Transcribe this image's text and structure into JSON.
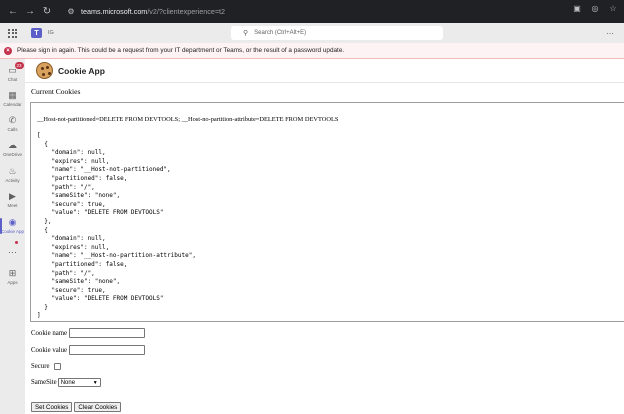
{
  "browser": {
    "url_host": "teams.microsoft.com",
    "url_path": "/v2/?clientexperience=t2"
  },
  "teams_header": {
    "org_label": "IG",
    "search_placeholder": "Search (Ctrl+Alt+E)"
  },
  "banner": {
    "text": "Please sign in again. This could be a request from your IT department or Teams, or the result of a password update."
  },
  "rail": {
    "items": [
      {
        "label": "Chat",
        "icon": "chat-icon",
        "badge": "23"
      },
      {
        "label": "Calendar",
        "icon": "calendar-icon"
      },
      {
        "label": "Calls",
        "icon": "calls-icon"
      },
      {
        "label": "OneDrive",
        "icon": "onedrive-icon"
      },
      {
        "label": "Activity",
        "icon": "activity-icon"
      },
      {
        "label": "Meet",
        "icon": "meet-icon"
      },
      {
        "label": "Cookie App",
        "icon": "cookie-app-icon",
        "active": true
      },
      {
        "label": "",
        "icon": "more-icon"
      },
      {
        "label": "Apps",
        "icon": "apps-icon"
      }
    ],
    "accent": "#5b5fc7"
  },
  "app": {
    "title": "Cookie App",
    "section_title": "Current Cookies",
    "cookie_string": "__Host-not-partitioned=DELETE FROM DEVTOOLS; __Host-no-partition-attribute=DELETE FROM DEVTOOLS",
    "cookies_json": "[\n  {\n    \"domain\": null,\n    \"expires\": null,\n    \"name\": \"__Host-not-partitioned\",\n    \"partitioned\": false,\n    \"path\": \"/\",\n    \"sameSite\": \"none\",\n    \"secure\": true,\n    \"value\": \"DELETE FROM DEVTOOLS\"\n  },\n  {\n    \"domain\": null,\n    \"expires\": null,\n    \"name\": \"__Host-no-partition-attribute\",\n    \"partitioned\": false,\n    \"path\": \"/\",\n    \"sameSite\": \"none\",\n    \"secure\": true,\n    \"value\": \"DELETE FROM DEVTOOLS\"\n  }\n]",
    "form": {
      "cookie_name_label": "Cookie name",
      "cookie_name_value": "",
      "cookie_value_label": "Cookie value",
      "cookie_value_value": "",
      "secure_label": "Secure",
      "secure_checked": false,
      "samesite_label": "SameSite",
      "samesite_selected": "None",
      "set_button": "Set Cookies",
      "clear_button": "Clear Cookies"
    }
  },
  "colors": {
    "banner_bg": "#fdf3f4",
    "error_red": "#c4314b",
    "browser_chrome": "#202124"
  }
}
